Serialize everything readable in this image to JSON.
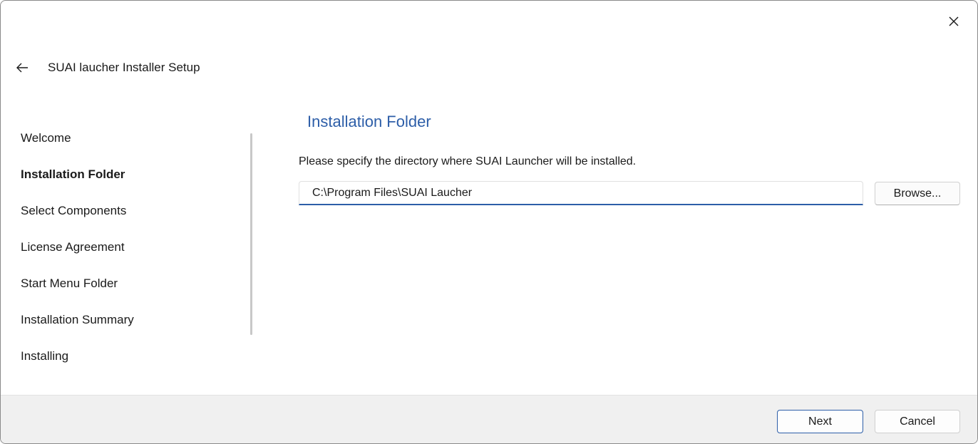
{
  "window": {
    "title": "SUAI laucher Installer Setup"
  },
  "sidebar": {
    "items": [
      {
        "label": "Welcome",
        "active": false
      },
      {
        "label": "Installation Folder",
        "active": true
      },
      {
        "label": "Select Components",
        "active": false
      },
      {
        "label": "License Agreement",
        "active": false
      },
      {
        "label": "Start Menu Folder",
        "active": false
      },
      {
        "label": "Installation Summary",
        "active": false
      },
      {
        "label": "Installing",
        "active": false
      }
    ]
  },
  "main": {
    "heading": "Installation Folder",
    "instruction": "Please specify the directory where SUAI Launcher will be installed.",
    "path_value": "C:\\Program Files\\SUAI Laucher",
    "browse_label": "Browse..."
  },
  "footer": {
    "next_label": "Next",
    "cancel_label": "Cancel"
  },
  "colors": {
    "accent": "#2d5ea8",
    "footer_bg": "#f0f0f0"
  },
  "icons": {
    "close": "close-icon",
    "back": "back-arrow-icon"
  }
}
